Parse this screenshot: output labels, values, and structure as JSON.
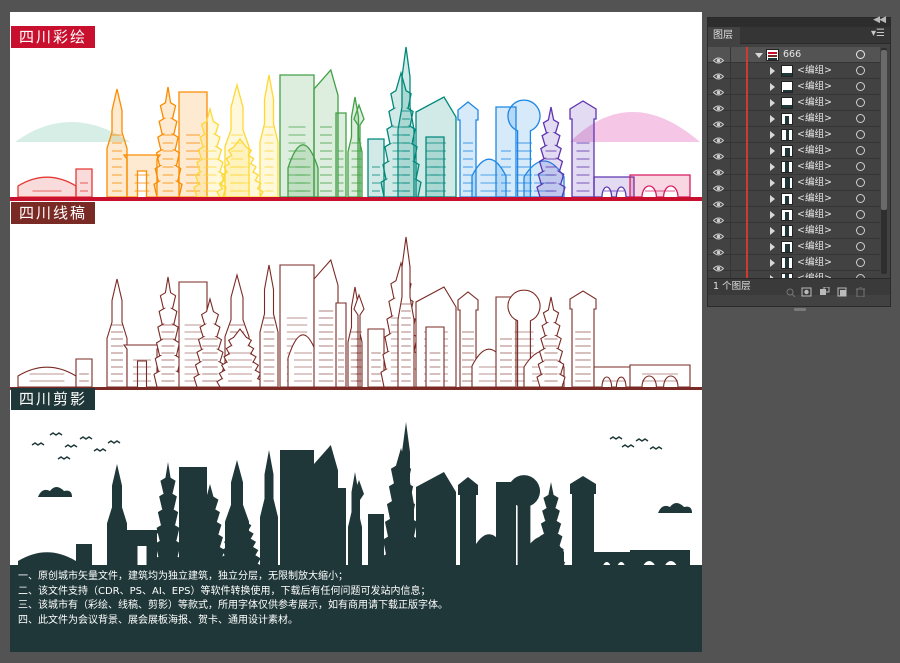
{
  "artboard": {
    "sections": {
      "color": {
        "label": "四川彩绘"
      },
      "line": {
        "label": "四川线稿"
      },
      "silhouette": {
        "label": "四川剪影"
      }
    },
    "colors": {
      "label_color_bg": "#c8102e",
      "label_line_bg": "#7a2a24",
      "label_sil_bg": "#1f3738",
      "line_art": "#7a2a24",
      "silhouette": "#1f3738",
      "ground_bar": "#c8102e",
      "rainbow": [
        "#e53935",
        "#fb8c00",
        "#fdd835",
        "#43a047",
        "#00897b",
        "#1e88e5",
        "#5e35b1",
        "#d81b60"
      ]
    },
    "info_lines": [
      "一、原创城市矢量文件，建筑均为独立建筑，独立分层，无限制放大缩小；",
      "二、该文件支持（CDR、PS、AI、EPS）等软件转换使用，下载后有任何问题可发站内信息；",
      "三、该城市有（彩绘、线稿、剪影）等款式，所用字体仅供参考展示，如有商用请下载正版字体。",
      "四、此文件为会议背景、展会展板海报、贺卡、通用设计素材。"
    ]
  },
  "layers_panel": {
    "tab_label": "图层",
    "collapse_icon": "double-chevron-left-icon",
    "menu_icon": "panel-menu-icon",
    "top_layer": {
      "name": "666",
      "expanded": true,
      "selected": true
    },
    "sublayers": [
      {
        "name": "<编组>"
      },
      {
        "name": "<编组>"
      },
      {
        "name": "<编组>"
      },
      {
        "name": "<编组>"
      },
      {
        "name": "<编组>"
      },
      {
        "name": "<编组>"
      },
      {
        "name": "<编组>"
      },
      {
        "name": "<编组>"
      },
      {
        "name": "<编组>"
      },
      {
        "name": "<编组>"
      },
      {
        "name": "<编组>"
      },
      {
        "name": "<编组>"
      },
      {
        "name": "<编组>"
      },
      {
        "name": "<编组>"
      }
    ],
    "footer": {
      "layer_count": "1 个图层",
      "buttons": [
        "locate-object-icon",
        "make-clipping-mask-icon",
        "new-sublayer-icon",
        "new-layer-icon",
        "delete-layer-icon"
      ]
    }
  }
}
